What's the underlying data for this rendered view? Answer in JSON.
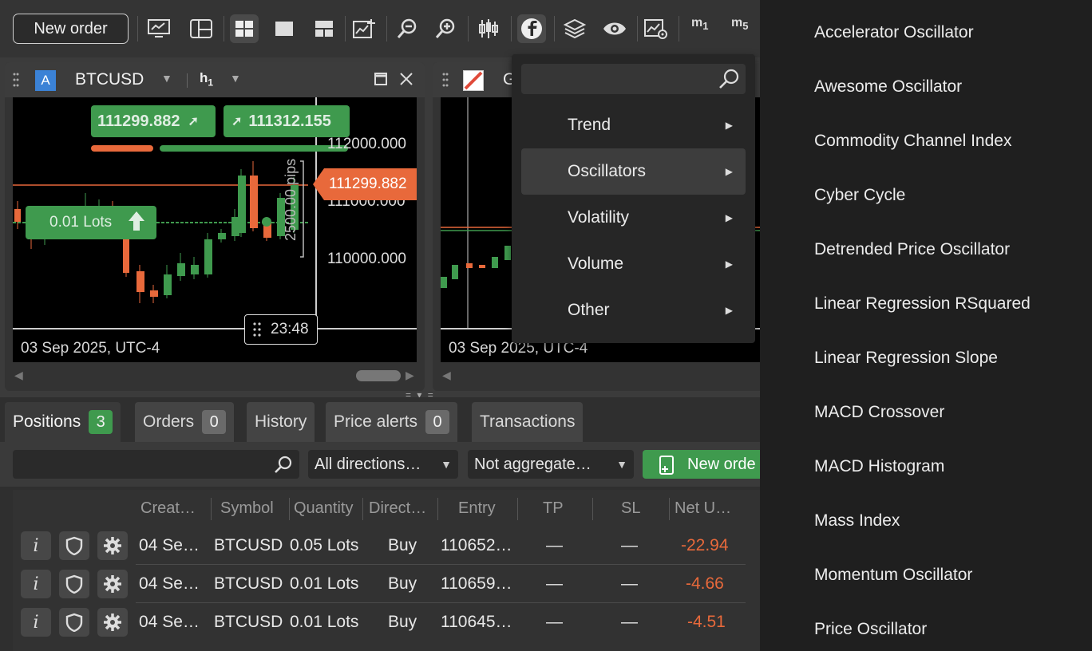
{
  "toolbar": {
    "new_order_label": "New order",
    "icons": [
      "monitor-chart-icon",
      "layout-icon",
      "grid-4-icon",
      "single-window-icon",
      "grid-3-icon",
      "add-chart-icon",
      "zoom-out-icon",
      "zoom-in-icon",
      "candles-icon",
      "indicators-icon",
      "layers-icon",
      "eye-icon",
      "chart-settings-icon"
    ],
    "timeframes": [
      {
        "base": "m",
        "sub": "1"
      },
      {
        "base": "m",
        "sub": "5"
      }
    ]
  },
  "chart1": {
    "badge": "A",
    "symbol": "BTCUSD",
    "timeframe_base": "h",
    "timeframe_sub": "1",
    "bid": "111299.882",
    "ask": "111312.155",
    "price_levels": [
      "112000.000",
      "111000.000",
      "110000.000"
    ],
    "current_price": "111299.882",
    "pips_label": "2500.00 pips",
    "lots_label": "0.01 Lots",
    "countdown": "23:48",
    "date": "03 Sep 2025, UTC-4"
  },
  "chart2": {
    "symbol_partial": "G",
    "date": "03 Sep 2025, UTC-4"
  },
  "indicator_menu": {
    "search_placeholder": "",
    "items": [
      {
        "label": "Trend"
      },
      {
        "label": "Oscillators"
      },
      {
        "label": "Volatility"
      },
      {
        "label": "Volume"
      },
      {
        "label": "Other"
      }
    ],
    "active_index": 1
  },
  "oscillators_submenu": [
    "Accelerator Oscillator",
    "Awesome Oscillator",
    "Commodity Channel Index",
    "Cyber Cycle",
    "Detrended Price Oscillator",
    "Linear Regression RSquared",
    "Linear Regression Slope",
    "MACD Crossover",
    "MACD Histogram",
    "Mass Index",
    "Momentum Oscillator",
    "Price Oscillator"
  ],
  "tabs": [
    {
      "label": "Positions",
      "count": "3"
    },
    {
      "label": "Orders",
      "count": "0"
    },
    {
      "label": "History"
    },
    {
      "label": "Price alerts",
      "count": "0"
    },
    {
      "label": "Transactions"
    }
  ],
  "filters": {
    "search_placeholder": "",
    "direction": "All directions…",
    "aggregation": "Not aggregate…",
    "new_order": "New orde"
  },
  "columns": [
    "Creat…",
    "Symbol",
    "Quantity",
    "Direct…",
    "Entry",
    "TP",
    "SL",
    "Net U…"
  ],
  "positions": [
    {
      "created": "04 Se…",
      "symbol": "BTCUSD",
      "quantity": "0.05 Lots",
      "direction": "Buy",
      "entry": "110652…",
      "tp": "—",
      "sl": "—",
      "net": "-22.94"
    },
    {
      "created": "04 Se…",
      "symbol": "BTCUSD",
      "quantity": "0.01 Lots",
      "direction": "Buy",
      "entry": "110659…",
      "tp": "—",
      "sl": "—",
      "net": "-4.66"
    },
    {
      "created": "04 Se…",
      "symbol": "BTCUSD",
      "quantity": "0.01 Lots",
      "direction": "Buy",
      "entry": "110645…",
      "tp": "—",
      "sl": "—",
      "net": "-4.51"
    }
  ],
  "colors": {
    "up": "#3f9a4e",
    "down": "#e8693b",
    "background": "#000000"
  }
}
